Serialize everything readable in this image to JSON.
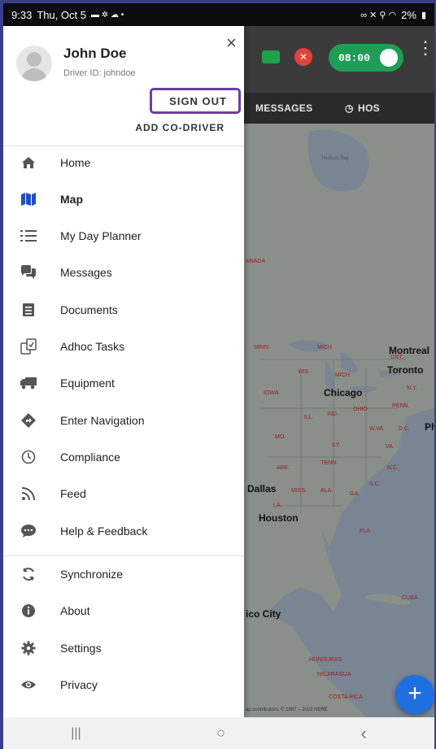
{
  "status_bar": {
    "time": "9:33",
    "date": "Thu, Oct 5",
    "battery": "2%"
  },
  "drawer": {
    "user_name": "John Doe",
    "driver_id": "Driver ID: johndoe",
    "sign_out_label": "SIGN OUT",
    "add_co_driver_label": "ADD CO-DRIVER",
    "close_glyph": "×",
    "items": [
      {
        "label": "Home",
        "icon": "home-icon"
      },
      {
        "label": "Map",
        "icon": "map-icon"
      },
      {
        "label": "My Day Planner",
        "icon": "list-icon"
      },
      {
        "label": "Messages",
        "icon": "chat-icon"
      },
      {
        "label": "Documents",
        "icon": "document-icon"
      },
      {
        "label": "Adhoc Tasks",
        "icon": "tasks-icon"
      },
      {
        "label": "Equipment",
        "icon": "truck-icon"
      },
      {
        "label": "Enter Navigation",
        "icon": "navigation-icon"
      },
      {
        "label": "Compliance",
        "icon": "clock-icon"
      },
      {
        "label": "Feed",
        "icon": "feed-icon"
      },
      {
        "label": "Help & Feedback",
        "icon": "feedback-icon"
      },
      {
        "label": "Synchronize",
        "icon": "sync-icon"
      },
      {
        "label": "About",
        "icon": "info-icon"
      },
      {
        "label": "Settings",
        "icon": "gear-icon"
      },
      {
        "label": "Privacy",
        "icon": "eye-icon"
      }
    ]
  },
  "topbar": {
    "timer": "08:00",
    "tabs": [
      "MESSAGES",
      "HOS"
    ]
  },
  "map": {
    "labels": {
      "hudson_bay": "Hudson Bay",
      "canada": "ANADA",
      "montreal": "Montreal",
      "ont": "ONT.",
      "toronto": "Toronto",
      "chicago": "Chicago",
      "dallas": "Dallas",
      "houston": "Houston",
      "mexico_city": "ico City",
      "ph": "Ph",
      "minn": "MINN.",
      "mich_top": "MICH.",
      "wis": "WIS.",
      "mich": "MICH.",
      "ny": "N.Y.",
      "iowa": "IOWA",
      "ill": "ILL.",
      "ind": "IND.",
      "ohio": "OHIO",
      "penn": "PENN.",
      "wva": "W.VA.",
      "dc": "D.C.",
      "mo": "MO.",
      "ky": "KY.",
      "va": "VA.",
      "ark": "ARK.",
      "tenn": "TENN.",
      "nc": "N.C.",
      "miss": "MISS.",
      "ala": "ALA.",
      "ga": "GA.",
      "sc": "S.C.",
      "la": "LA.",
      "fla": "FLA.",
      "cuba": "CUBA",
      "honduras": "HONDURAS",
      "nicaragua": "NICARAGUA",
      "costa_rica": "COSTA RICA",
      "attribution": "ap contributors, © 1987 – 2023 HERE"
    }
  },
  "nav_bar": {
    "recents": "|||",
    "home": "○",
    "back": "‹"
  },
  "colors": {
    "accent": "#6b3fa0",
    "map_icon": "#1e4fbf",
    "fab": "#1f6fe0",
    "timer_bg": "#1f9d55"
  }
}
